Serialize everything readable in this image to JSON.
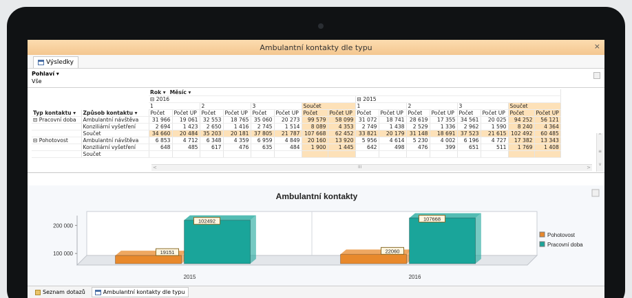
{
  "window": {
    "title": "Ambulantní kontakty dle typu",
    "close": "×"
  },
  "tab": {
    "label": "Výsledky"
  },
  "filter": {
    "field": "Pohlaví",
    "arrow": "▾",
    "value": "Vše"
  },
  "pivot": {
    "header_fields": [
      "Rok ▾",
      "Měsíc ▾"
    ],
    "years": [
      "⊟ 2016",
      "⊟ 2015"
    ],
    "months": [
      "1",
      "2",
      "3",
      "Součet",
      "1",
      "2",
      "3",
      "Součet"
    ],
    "measures": [
      "Počet",
      "Počet UP",
      "Počet",
      "Počet UP",
      "Počet",
      "Počet UP",
      "Počet",
      "Počet UP",
      "Počet",
      "Počet UP",
      "Počet",
      "Počet UP",
      "Počet",
      "Počet UP",
      "Počet",
      "Počet UP"
    ],
    "row_fields": [
      "Typ kontaktu ▾",
      "Způsob kontaktu ▾"
    ],
    "rows": [
      {
        "type": "⊟ Pracovní doba",
        "way": "Ambulantní návštěva",
        "sum": false,
        "values": [
          "31 966",
          "19 061",
          "32 553",
          "18 765",
          "35 060",
          "20 273",
          "99 579",
          "58 099",
          "31 072",
          "18 741",
          "28 619",
          "17 355",
          "34 561",
          "20 025",
          "94 252",
          "56 121"
        ]
      },
      {
        "type": "",
        "way": "Konziliární vyšetření",
        "sum": false,
        "values": [
          "2 694",
          "1 423",
          "2 650",
          "1 416",
          "2 745",
          "1 514",
          "8 089",
          "4 353",
          "2 749",
          "1 438",
          "2 529",
          "1 336",
          "2 962",
          "1 590",
          "8 240",
          "4 364"
        ]
      },
      {
        "type": "",
        "way": "Součet",
        "sum": true,
        "values": [
          "34 660",
          "20 484",
          "35 203",
          "20 181",
          "37 805",
          "21 787",
          "107 668",
          "62 452",
          "33 821",
          "20 179",
          "31 148",
          "18 691",
          "37 523",
          "21 615",
          "102 492",
          "60 485"
        ]
      },
      {
        "type": "⊟ Pohotovost",
        "way": "Ambulantní návštěva",
        "sum": false,
        "values": [
          "6 853",
          "4 712",
          "6 348",
          "4 359",
          "6 959",
          "4 849",
          "20 160",
          "13 920",
          "5 956",
          "4 614",
          "5 230",
          "4 002",
          "6 196",
          "4 727",
          "17 382",
          "13 343"
        ]
      },
      {
        "type": "",
        "way": "Konziliární vyšetření",
        "sum": false,
        "values": [
          "648",
          "485",
          "617",
          "476",
          "635",
          "484",
          "1 900",
          "1 445",
          "642",
          "498",
          "476",
          "399",
          "651",
          "511",
          "1 769",
          "1 408"
        ]
      },
      {
        "type": "",
        "way": "Součet",
        "sum": false,
        "values": []
      }
    ],
    "scroll_marker": "III",
    "scroll_left": "<",
    "scroll_right": ">"
  },
  "chart_data": {
    "type": "bar",
    "title": "Ambulantní kontakty",
    "categories": [
      "2015",
      "2016"
    ],
    "series": [
      {
        "name": "Pohotovost",
        "values": [
          19151,
          22060
        ],
        "color": "#e8892c"
      },
      {
        "name": "Pracovní doba",
        "values": [
          102492,
          107668
        ],
        "color": "#1aa59a"
      }
    ],
    "y_ticks": [
      "200 000",
      "100 000"
    ],
    "ylim": [
      0,
      250000
    ],
    "legend": "right"
  },
  "bottom_tabs": [
    {
      "label": "Seznam dotazů",
      "active": false
    },
    {
      "label": "Ambulantní kontakty dle typu",
      "active": true
    }
  ]
}
